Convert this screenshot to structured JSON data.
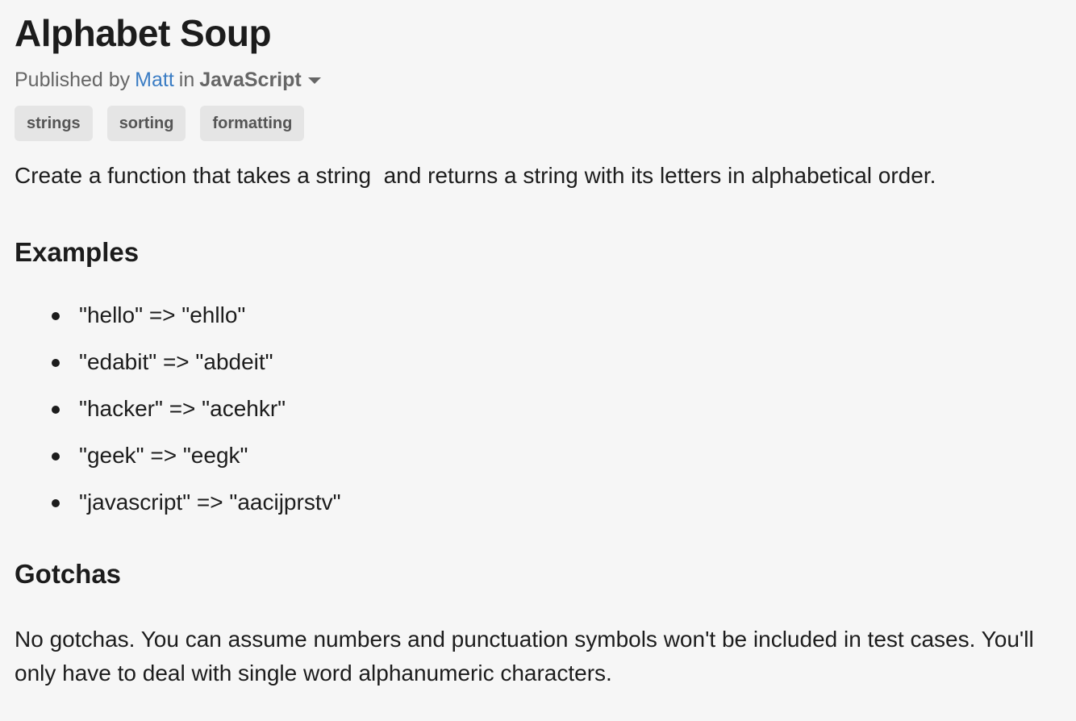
{
  "challenge": {
    "title": "Alphabet Soup",
    "published_by_label": "Published by",
    "author": "Matt",
    "in_label": "in",
    "language": "JavaScript"
  },
  "tags": [
    "strings",
    "sorting",
    "formatting"
  ],
  "description": "Create a function that takes a string  and returns a string with its letters in alphabetical order.",
  "examples": {
    "heading": "Examples",
    "items": [
      "\"hello\" => \"ehllo\"",
      "\"edabit\" => \"abdeit\"",
      "\"hacker\" => \"acehkr\"",
      "\"geek\" => \"eegk\"",
      "\"javascript\" => \"aacijprstv\""
    ]
  },
  "gotchas": {
    "heading": "Gotchas",
    "text": "No gotchas. You can assume numbers and punctuation symbols won't be included in test cases. You'll only have to deal with single word alphanumeric characters."
  },
  "icons": {
    "language_dropdown": "caret-down-icon"
  },
  "colors": {
    "author_link": "#3b7dc4",
    "tag_background": "#e5e5e5",
    "page_background": "#f6f6f6"
  }
}
